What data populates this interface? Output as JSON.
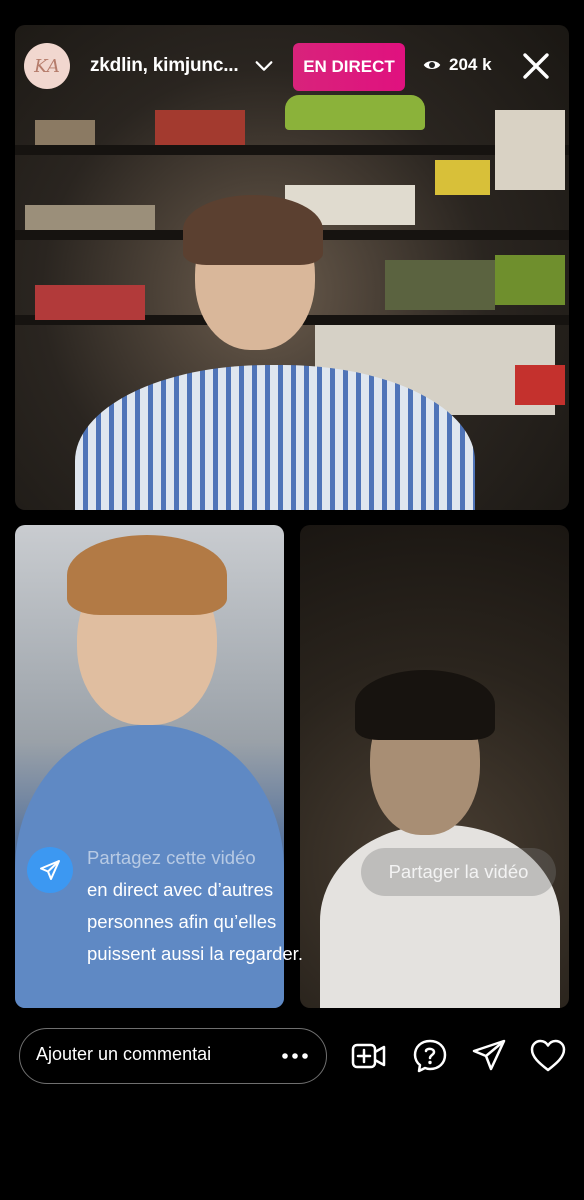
{
  "header": {
    "avatar_initials": "KA",
    "participants": "zkdlin, kimjunc...",
    "live_badge": "EN DIRECT",
    "viewer_count": "204 k"
  },
  "share_prompt": {
    "line_faded": "Partagez cette vidéo",
    "line_rest": "en direct avec d’autres personnes afin qu’elles puissent aussi la regarder.",
    "button_label": "Partager la vidéo"
  },
  "bottom_bar": {
    "comment_placeholder": "Ajouter un commentai",
    "icons": [
      "more-icon",
      "add-video-icon",
      "question-icon",
      "send-icon",
      "heart-icon"
    ]
  },
  "colors": {
    "live_badge": "#e0117f",
    "share_icon_bg": "#3c98f2",
    "background": "#000000"
  }
}
